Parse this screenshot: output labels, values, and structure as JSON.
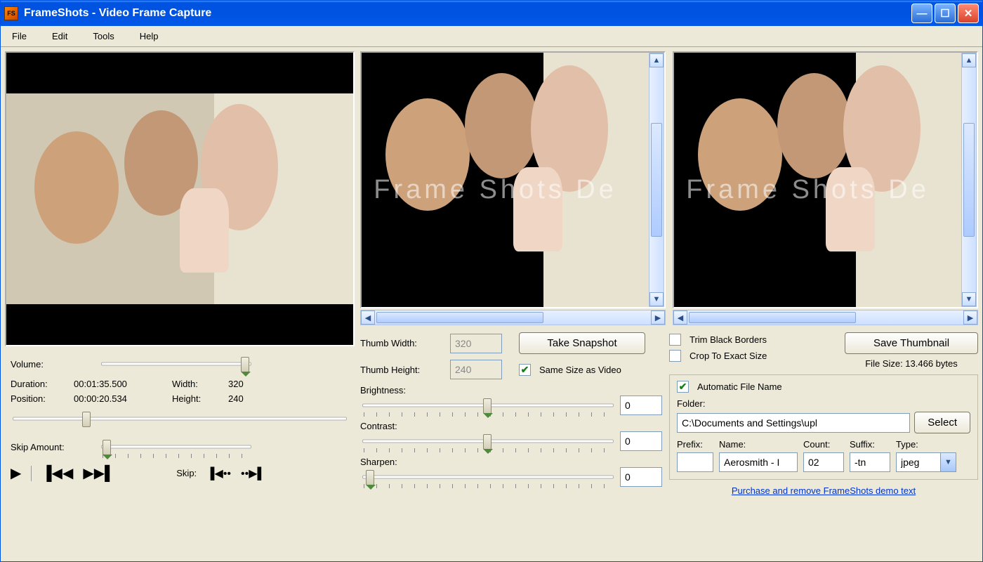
{
  "window": {
    "title": "FrameShots - Video Frame Capture"
  },
  "menu": {
    "file": "File",
    "edit": "Edit",
    "tools": "Tools",
    "help": "Help"
  },
  "left": {
    "volume_label": "Volume:",
    "duration_label": "Duration:",
    "duration_value": "00:01:35.500",
    "width_label": "Width:",
    "width_value": "320",
    "position_label": "Position:",
    "position_value": "00:00:20.534",
    "height_label": "Height:",
    "height_value": "240",
    "skip_amount_label": "Skip Amount:",
    "skip_label": "Skip:"
  },
  "mid": {
    "thumb_width_label": "Thumb Width:",
    "thumb_width_value": "320",
    "thumb_height_label": "Thumb Height:",
    "thumb_height_value": "240",
    "take_snapshot": "Take Snapshot",
    "same_size_label": "Same Size as Video",
    "brightness_label": "Brightness:",
    "brightness_value": "0",
    "contrast_label": "Contrast:",
    "contrast_value": "0",
    "sharpen_label": "Sharpen:",
    "sharpen_value": "0"
  },
  "right": {
    "trim_label": "Trim Black Borders",
    "crop_label": "Crop To Exact Size",
    "save_thumbnail": "Save Thumbnail",
    "file_size_label": "File Size: 13.466 bytes",
    "auto_name_label": "Automatic File Name",
    "folder_label": "Folder:",
    "folder_value": "C:\\Documents and Settings\\upl",
    "select_btn": "Select",
    "prefix_label": "Prefix:",
    "name_label": "Name:",
    "count_label": "Count:",
    "suffix_label": "Suffix:",
    "type_label": "Type:",
    "prefix_value": "",
    "name_value": "Aerosmith - I",
    "count_value": "02",
    "suffix_value": "-tn",
    "type_value": "jpeg",
    "purchase_link": "Purchase and remove FrameShots demo text"
  },
  "watermark": "Frame Shots De"
}
